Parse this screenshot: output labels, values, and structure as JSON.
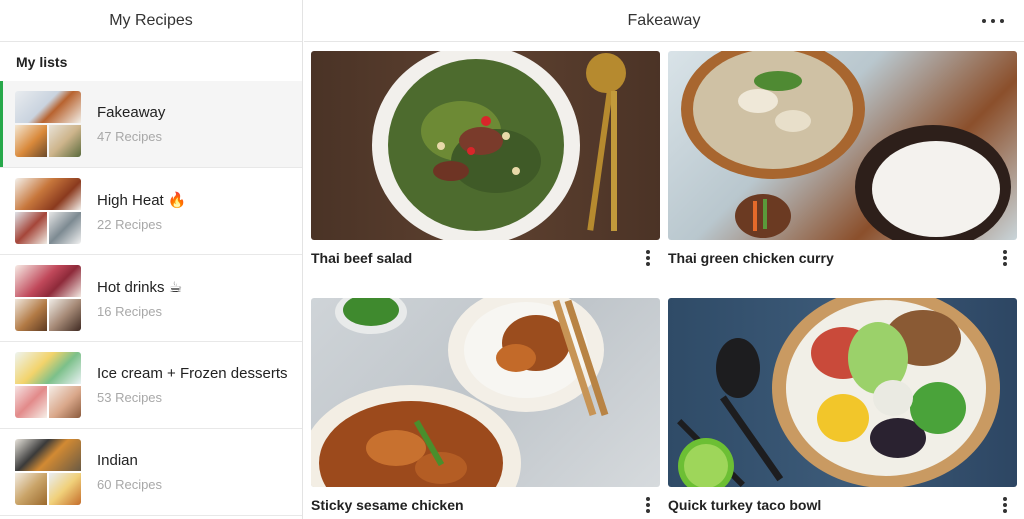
{
  "sidebar": {
    "title": "My Recipes",
    "section_label": "My lists",
    "items": [
      {
        "title": "Fakeaway",
        "count": "47 Recipes",
        "active": true
      },
      {
        "title": "High Heat 🔥",
        "count": "22 Recipes",
        "active": false
      },
      {
        "title": "Hot drinks ☕",
        "count": "16 Recipes",
        "active": false
      },
      {
        "title": "Ice cream + Frozen desserts",
        "count": "53 Recipes",
        "active": false
      },
      {
        "title": "Indian",
        "count": "60 Recipes",
        "active": false
      }
    ]
  },
  "main": {
    "title": "Fakeaway",
    "more_icon": "more-horizontal-icon",
    "recipes": [
      {
        "name": "Thai beef salad"
      },
      {
        "name": "Thai green chicken curry"
      },
      {
        "name": "Sticky sesame chicken"
      },
      {
        "name": "Quick turkey taco bowl"
      }
    ]
  },
  "colors": {
    "accent": "#27a84a",
    "muted_text": "#a8a8a8"
  }
}
